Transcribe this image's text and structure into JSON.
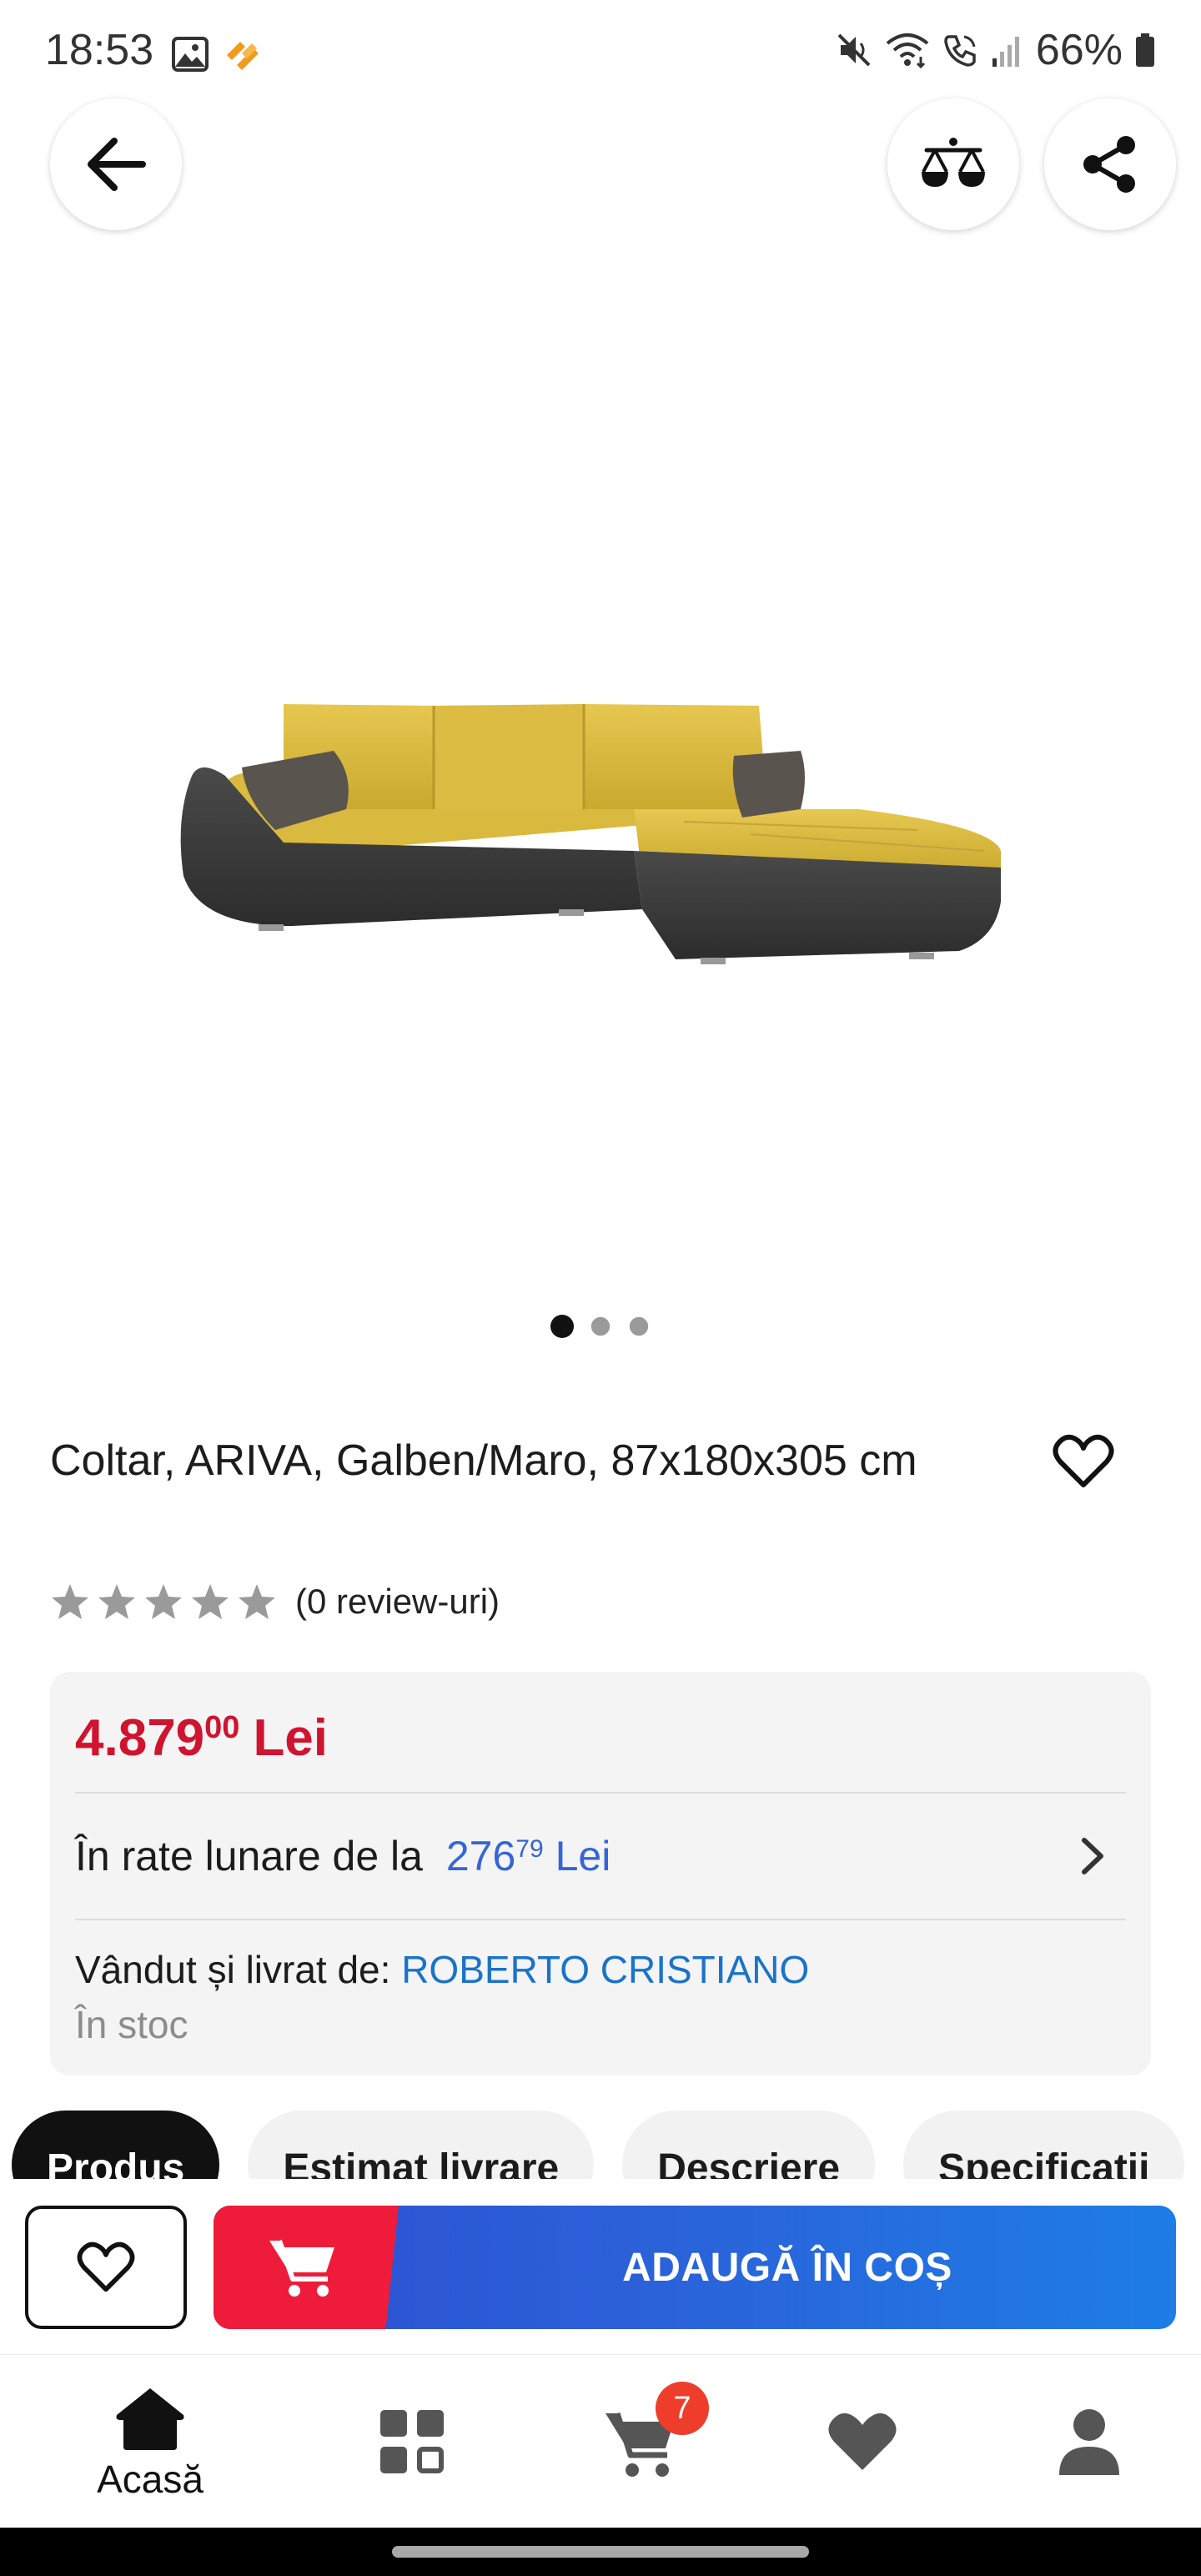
{
  "status_bar": {
    "time": "18:53",
    "battery": "66%"
  },
  "header": {
    "back_icon": "arrow-left-icon",
    "compare_icon": "scale-compare-icon",
    "share_icon": "share-icon"
  },
  "gallery": {
    "image_alt": "Coltar, ARIVA, Galben/Maro",
    "slide_count": 3,
    "active_slide": 1
  },
  "product": {
    "title": "Coltar, ARIVA, Galben/Maro, 87x180x305 cm",
    "rating_stars": 0,
    "review_count": "(0 review-uri)"
  },
  "price": {
    "integer": "4.879",
    "cents": "00",
    "currency": "Lei",
    "installments_prefix": "În rate lunare de la",
    "installments_integer": "276",
    "installments_cents": "79",
    "installments_currency": "Lei",
    "seller_prefix": "Vândut și livrat de:",
    "seller_name": "ROBERTO CRISTIANO",
    "stock": "În stoc"
  },
  "tabs": [
    {
      "label": "Produs",
      "active": true
    },
    {
      "label": "Estimat livrare",
      "active": false
    },
    {
      "label": "Descriere",
      "active": false
    },
    {
      "label": "Specificatii",
      "active": false
    }
  ],
  "actions": {
    "add_to_cart_label": "ADAUGĂ ÎN COȘ"
  },
  "bottom_nav": {
    "home_label": "Acasă",
    "cart_badge": "7"
  },
  "colors": {
    "price_red": "#d0132e",
    "link_blue": "#1a73c9",
    "cart_red": "#ee1c3a",
    "cart_blue": "#2b61d9",
    "star_gray": "#9a9a9a"
  }
}
